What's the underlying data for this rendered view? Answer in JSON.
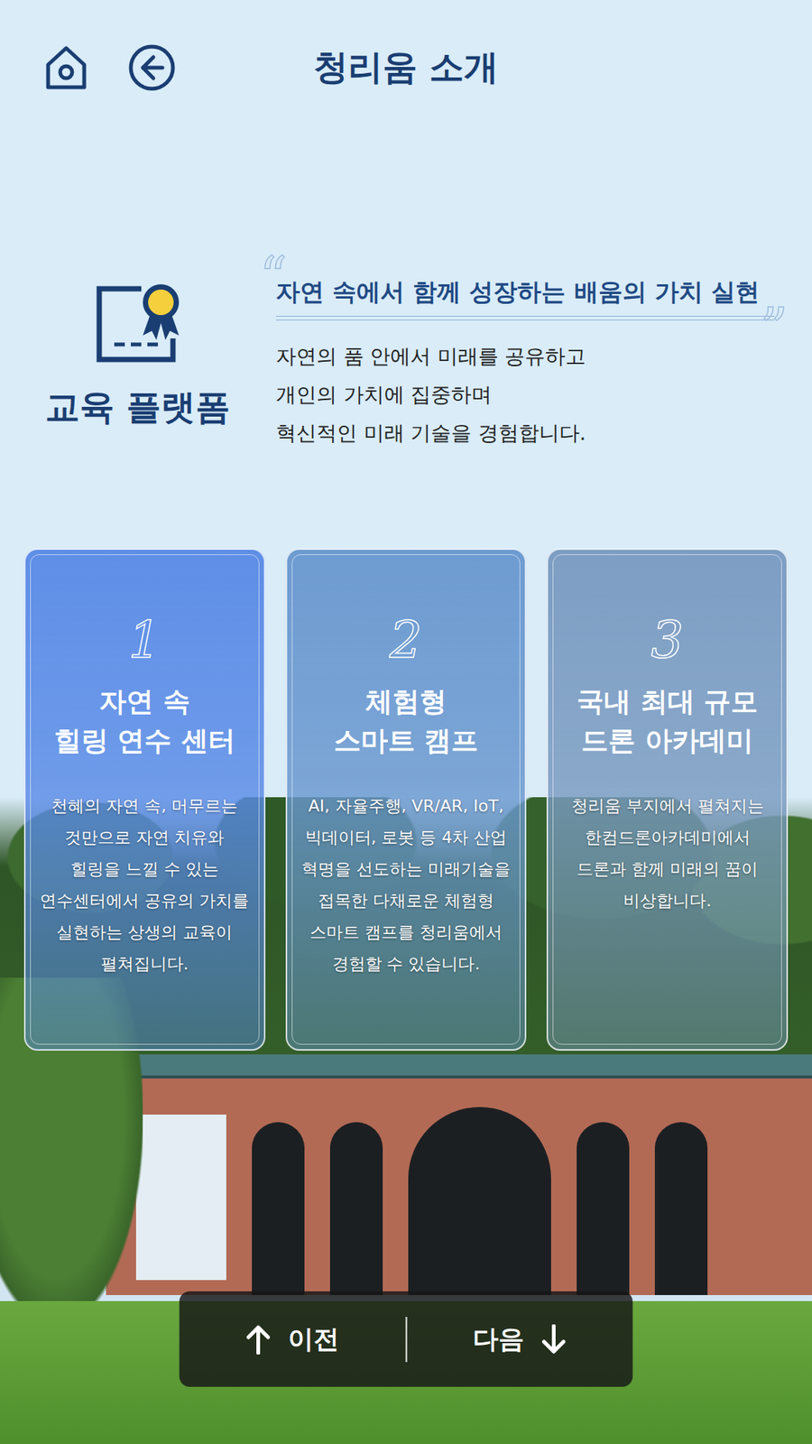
{
  "header": {
    "title": "청리움 소개"
  },
  "intro": {
    "label": "교육 플랫폼",
    "open_quote": "“",
    "close_quote": "”",
    "heading": "자연 속에서 함께 성장하는 배움의 가치 실현",
    "lines": [
      "자연의 품 안에서 미래를 공유하고",
      "개인의 가치에 집중하며",
      "혁신적인 미래 기술을 경험합니다."
    ]
  },
  "cards": [
    {
      "number": "1",
      "title": [
        "자연 속",
        "힐링 연수 센터"
      ],
      "color": "#5a8be6",
      "body": [
        "천혜의 자연 속, 머무르는",
        "것만으로 자연 치유와",
        "힐링을 느낄 수 있는",
        "연수센터에서 공유의 가치를",
        "실현하는 상생의 교육이",
        "펼쳐집니다."
      ]
    },
    {
      "number": "2",
      "title": [
        "체험형",
        "스마트 캠프"
      ],
      "color": "#6a98cf",
      "body": [
        "AI, 자율주행, VR/AR, IoT,",
        "빅데이터, 로봇 등 4차 산업",
        "혁명을 선도하는 미래기술을",
        "접목한 다채로운 체험형",
        "스마트 캠프를 청리움에서",
        "경험할 수 있습니다."
      ]
    },
    {
      "number": "3",
      "title": [
        "국내 최대 규모",
        "드론 아카데미"
      ],
      "color": "#7a9bc1",
      "body": [
        "청리움 부지에서 펼쳐지는",
        "한컴드론아카데미에서",
        "드론과 함께 미래의 꿈이",
        "비상합니다."
      ]
    }
  ],
  "pager": {
    "prev": "이전",
    "next": "다음"
  }
}
